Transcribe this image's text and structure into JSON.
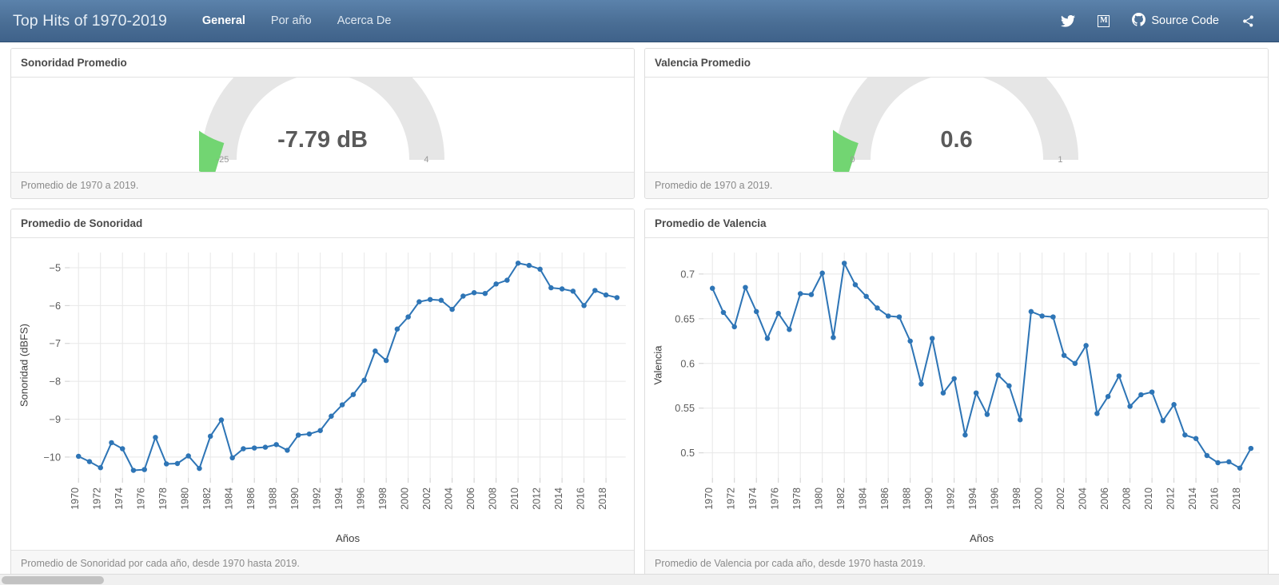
{
  "navbar": {
    "brand": "Top Hits of 1970-2019",
    "links": [
      {
        "label": "General",
        "active": true
      },
      {
        "label": "Por año",
        "active": false
      },
      {
        "label": "Acerca De",
        "active": false
      }
    ],
    "icons": {
      "twitter": "twitter-icon",
      "medium": "M",
      "github": "github-icon",
      "share": "share-icon"
    },
    "source_code_label": "Source Code",
    "background_color": "#4a6e95"
  },
  "cards": {
    "loudness_gauge": {
      "title": "Sonoridad Promedio",
      "footer": "Promedio de 1970 a 2019.",
      "value_label": "-7.79 dB",
      "value": -7.79,
      "min_label": "-25",
      "max_label": "4",
      "min": -25,
      "max": 4,
      "fill_color": "#72d572",
      "track_color": "#e6e6e6"
    },
    "valence_gauge": {
      "title": "Valencia Promedio",
      "footer": "Promedio de 1970 a 2019.",
      "value_label": "0.6",
      "value": 0.6,
      "min_label": "0",
      "max_label": "1",
      "min": 0,
      "max": 1,
      "fill_color": "#72d572",
      "track_color": "#e6e6e6"
    },
    "loudness_chart": {
      "title": "Promedio de Sonoridad",
      "footer": "Promedio de Sonoridad por cada año, desde 1970 hasta 2019."
    },
    "valence_chart": {
      "title": "Promedio de Valencia",
      "footer": "Promedio de Valencia por cada año, desde 1970 hasta 2019."
    }
  },
  "chart_data": [
    {
      "type": "line",
      "id": "loudness",
      "title": "Promedio de Sonoridad",
      "xlabel": "Años",
      "ylabel": "Sonoridad (dBFS)",
      "series_color": "#2e75b6",
      "grid": true,
      "legend": "none",
      "xlim": [
        1969.2,
        2019.8
      ],
      "ylim": [
        -10.55,
        -4.6
      ],
      "ytick_labels": [
        "−5",
        "−6",
        "−7",
        "−8",
        "−9",
        "−10"
      ],
      "yticks": [
        -5,
        -6,
        -7,
        -8,
        -9,
        -10
      ],
      "xtick_labels": [
        "1970",
        "1972",
        "1974",
        "1976",
        "1978",
        "1980",
        "1982",
        "1984",
        "1986",
        "1988",
        "1990",
        "1992",
        "1994",
        "1996",
        "1998",
        "2000",
        "2002",
        "2004",
        "2006",
        "2008",
        "2010",
        "2012",
        "2014",
        "2016",
        "2018"
      ],
      "xticks": [
        1970,
        1972,
        1974,
        1976,
        1978,
        1980,
        1982,
        1984,
        1986,
        1988,
        1990,
        1992,
        1994,
        1996,
        1998,
        2000,
        2002,
        2004,
        2006,
        2008,
        2010,
        2012,
        2014,
        2016,
        2018
      ],
      "x": [
        1970,
        1971,
        1972,
        1973,
        1974,
        1975,
        1976,
        1977,
        1978,
        1979,
        1980,
        1981,
        1982,
        1983,
        1984,
        1985,
        1986,
        1987,
        1988,
        1989,
        1990,
        1991,
        1992,
        1993,
        1994,
        1995,
        1996,
        1997,
        1998,
        1999,
        2000,
        2001,
        2002,
        2003,
        2004,
        2005,
        2006,
        2007,
        2008,
        2009,
        2010,
        2011,
        2012,
        2013,
        2014,
        2015,
        2016,
        2017,
        2018,
        2019
      ],
      "values": [
        -9.98,
        -10.12,
        -10.28,
        -9.62,
        -9.78,
        -10.35,
        -10.33,
        -9.48,
        -10.18,
        -10.17,
        -9.97,
        -10.3,
        -9.45,
        -9.02,
        -10.02,
        -9.78,
        -9.76,
        -9.74,
        -9.67,
        -9.82,
        -9.42,
        -9.39,
        -9.3,
        -8.92,
        -8.62,
        -8.35,
        -7.97,
        -7.2,
        -7.45,
        -6.62,
        -6.3,
        -5.9,
        -5.84,
        -5.86,
        -6.1,
        -5.75,
        -5.66,
        -5.68,
        -5.43,
        -5.33,
        -4.88,
        -4.94,
        -5.04,
        -5.53,
        -5.56,
        -5.62,
        -6.0,
        -5.6,
        -5.72,
        -5.79
      ]
    },
    {
      "type": "line",
      "id": "valence",
      "title": "Promedio de Valencia",
      "xlabel": "Años",
      "ylabel": "Valencia",
      "series_color": "#2e75b6",
      "grid": true,
      "legend": "none",
      "xlim": [
        1969.2,
        2019.8
      ],
      "ylim": [
        0.472,
        0.724
      ],
      "ytick_labels": [
        "0.7",
        "0.65",
        "0.6",
        "0.55",
        "0.5"
      ],
      "yticks": [
        0.7,
        0.65,
        0.6,
        0.55,
        0.5
      ],
      "xtick_labels": [
        "1970",
        "1972",
        "1974",
        "1976",
        "1978",
        "1980",
        "1982",
        "1984",
        "1986",
        "1988",
        "1990",
        "1992",
        "1994",
        "1996",
        "1998",
        "2000",
        "2002",
        "2004",
        "2006",
        "2008",
        "2010",
        "2012",
        "2014",
        "2016",
        "2018"
      ],
      "xticks": [
        1970,
        1972,
        1974,
        1976,
        1978,
        1980,
        1982,
        1984,
        1986,
        1988,
        1990,
        1992,
        1994,
        1996,
        1998,
        2000,
        2002,
        2004,
        2006,
        2008,
        2010,
        2012,
        2014,
        2016,
        2018
      ],
      "x": [
        1970,
        1971,
        1972,
        1973,
        1974,
        1975,
        1976,
        1977,
        1978,
        1979,
        1980,
        1981,
        1982,
        1983,
        1984,
        1985,
        1986,
        1987,
        1988,
        1989,
        1990,
        1991,
        1992,
        1993,
        1994,
        1995,
        1996,
        1997,
        1998,
        1999,
        2000,
        2001,
        2002,
        2003,
        2004,
        2005,
        2006,
        2007,
        2008,
        2009,
        2010,
        2011,
        2012,
        2013,
        2014,
        2015,
        2016,
        2017,
        2018,
        2019
      ],
      "values": [
        0.684,
        0.657,
        0.641,
        0.685,
        0.658,
        0.628,
        0.656,
        0.638,
        0.678,
        0.677,
        0.701,
        0.629,
        0.712,
        0.688,
        0.675,
        0.662,
        0.653,
        0.652,
        0.625,
        0.577,
        0.628,
        0.567,
        0.583,
        0.52,
        0.567,
        0.543,
        0.587,
        0.575,
        0.537,
        0.658,
        0.653,
        0.652,
        0.609,
        0.6,
        0.62,
        0.544,
        0.563,
        0.586,
        0.552,
        0.565,
        0.568,
        0.536,
        0.554,
        0.52,
        0.516,
        0.497,
        0.489,
        0.49,
        0.483,
        0.505
      ]
    }
  ],
  "scrollbar": {
    "orientation": "horizontal"
  }
}
